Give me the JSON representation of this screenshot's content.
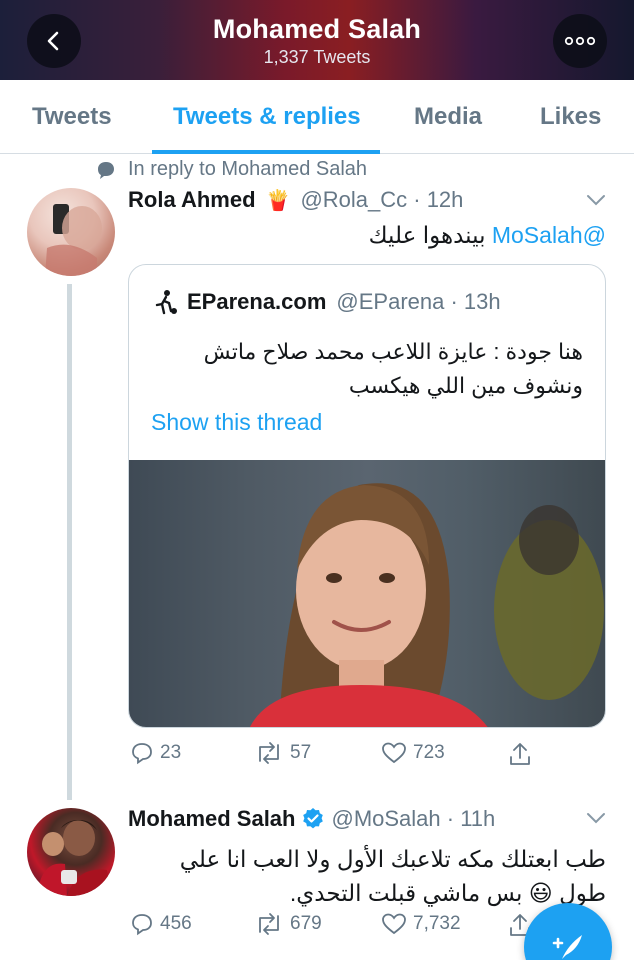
{
  "header": {
    "title": "Mohamed Salah",
    "subtitle": "1,337 Tweets",
    "back_icon": "chevron-left-icon",
    "more_icon": "more-horizontal-icon"
  },
  "tabs": [
    {
      "label": "Tweets"
    },
    {
      "label": "Tweets & replies",
      "active": true
    },
    {
      "label": "Media"
    },
    {
      "label": "Likes"
    }
  ],
  "colors": {
    "accent": "#1da1f2",
    "secondary_text": "#657786",
    "border": "#ccd6dd"
  },
  "tweets": [
    {
      "reply_context": "In reply to Mohamed Salah",
      "name": "Rola Ahmed",
      "name_badge": "🍟",
      "handle_time": "@Rola_Cc · 12h",
      "mention": "@MoSalah",
      "text": "بيندهوا عليك",
      "quote": {
        "name": "EParena.com",
        "handle_time": "@EParena · 13h",
        "text": "هنا جودة : عايزة اللاعب محمد صلاح ماتش ونشوف مين اللي هيكسب",
        "link": "Show this thread"
      },
      "actions": {
        "replies": "23",
        "retweets": "57",
        "likes": "723"
      }
    },
    {
      "name": "Mohamed Salah",
      "verified": true,
      "handle_time": "@MoSalah · 11h",
      "text": "طب ابعتلك مكه تلاعبك الأول ولا العب انا علي طول 😃 بس ماشي قبلت التحدي.",
      "actions": {
        "replies": "456",
        "retweets": "679",
        "likes": "7,732"
      }
    }
  ],
  "fab": {
    "icon": "compose-tweet-icon"
  }
}
